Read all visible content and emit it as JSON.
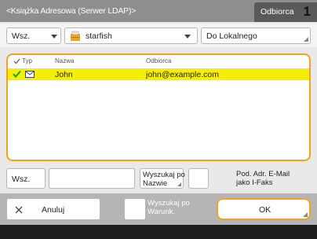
{
  "header": {
    "title": "<Książka Adresowa (Serwer LDAP)>",
    "recipient_tab_label": "Odbiorca",
    "recipient_count": "1"
  },
  "toolbar": {
    "search_select": "Wsz.",
    "server_select": "starfish",
    "to_local_label": "Do Lokalnego"
  },
  "list": {
    "columns": {
      "type": "Typ",
      "name": "Nazwa",
      "recipient": "Odbiorca"
    },
    "rows": [
      {
        "checked": true,
        "type_icon": "envelope-icon",
        "name": "John",
        "recipient": "john@example.com"
      }
    ]
  },
  "bottom": {
    "search_all_label": "Wsz.",
    "search_input": "",
    "search_by_name_label": "Wyszukaj po\nNazwie",
    "show_email_label": "Pod. Adr. E-Mail\njako I-Faks"
  },
  "footer": {
    "cancel_label": "Anuluj",
    "search_condition_label": "Wyszukaj po\nWarunk.",
    "ok_label": "OK"
  },
  "colors": {
    "accent": "#f0a322",
    "selected_row": "#f4ef00",
    "header_bg": "#8e8e8e"
  }
}
